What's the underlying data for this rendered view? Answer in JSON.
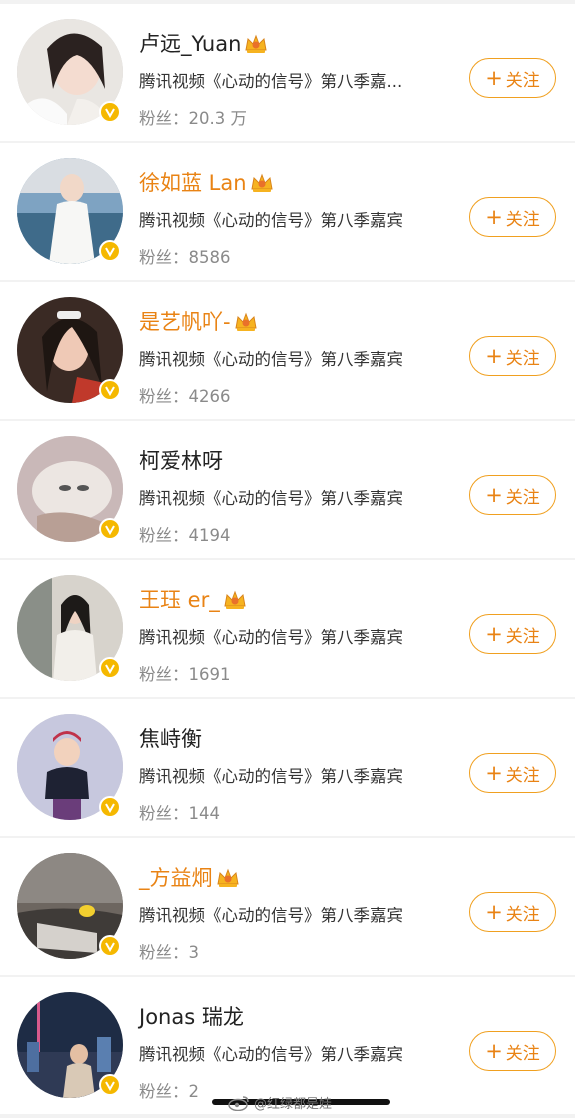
{
  "accent_color": "#e98314",
  "verified_color": "#f5b800",
  "follow_label": "关注",
  "fans_prefix": "粉丝：",
  "users": [
    {
      "name": "卢远_Yuan",
      "vip": true,
      "desc": "腾讯视频《心动的信号》第八季嘉...",
      "fans": "20.3 万"
    },
    {
      "name": "徐如蓝 Lan",
      "vip": true,
      "desc": "腾讯视频《心动的信号》第八季嘉宾",
      "fans": "8586"
    },
    {
      "name": "是艺帆吖-",
      "vip": true,
      "desc": "腾讯视频《心动的信号》第八季嘉宾",
      "fans": "4266"
    },
    {
      "name": "柯爱林呀",
      "vip": false,
      "desc": "腾讯视频《心动的信号》第八季嘉宾",
      "fans": "4194"
    },
    {
      "name": "王珏 er_",
      "vip": true,
      "desc": "腾讯视频《心动的信号》第八季嘉宾",
      "fans": "1691"
    },
    {
      "name": "焦峙衡",
      "vip": false,
      "desc": "腾讯视频《心动的信号》第八季嘉宾",
      "fans": "144"
    },
    {
      "name": "_方益炯",
      "vip": true,
      "desc": "腾讯视频《心动的信号》第八季嘉宾",
      "fans": "3"
    },
    {
      "name": "Jonas 瑞龙",
      "vip": false,
      "desc": "腾讯视频《心动的信号》第八季嘉宾",
      "fans": "2"
    }
  ],
  "watermark": "@红绿都是娃"
}
